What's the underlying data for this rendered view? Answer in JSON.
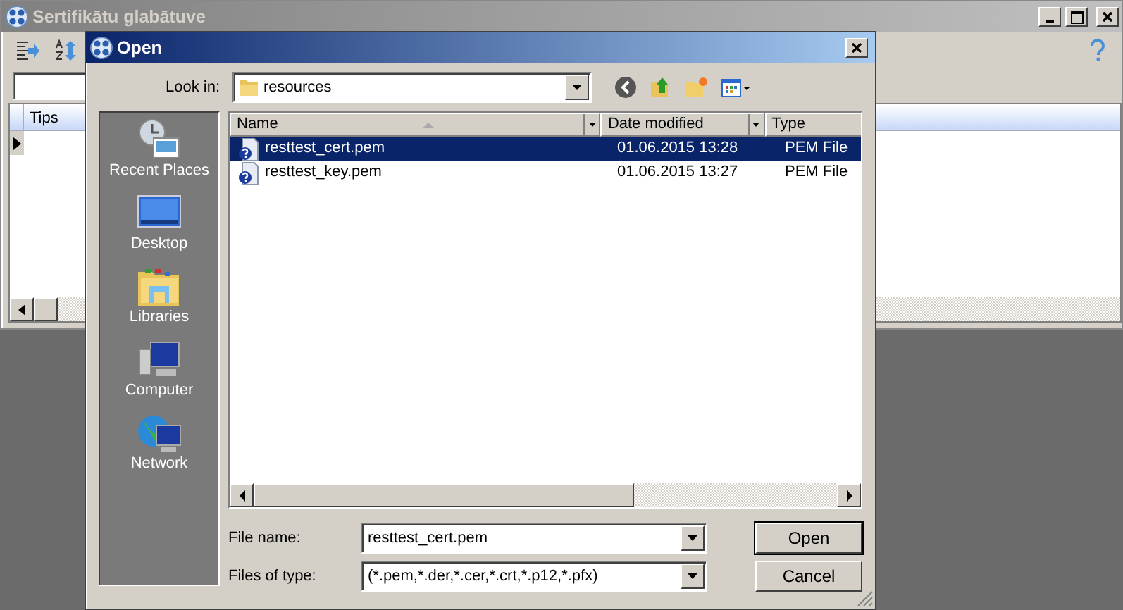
{
  "main_window": {
    "title": "Sertifikātu glabātuve",
    "table": {
      "columns": [
        "Tips"
      ]
    }
  },
  "dialog": {
    "title": "Open",
    "look_in": {
      "label": "Look in:",
      "value": "resources"
    },
    "places": [
      {
        "label": "Recent Places",
        "kind": "recent"
      },
      {
        "label": "Desktop",
        "kind": "desktop"
      },
      {
        "label": "Libraries",
        "kind": "libraries"
      },
      {
        "label": "Computer",
        "kind": "computer"
      },
      {
        "label": "Network",
        "kind": "network"
      }
    ],
    "file_list": {
      "columns": [
        {
          "label": "Name",
          "sorted": true
        },
        {
          "label": "Date modified",
          "sorted": false
        },
        {
          "label": "Type",
          "sorted": false
        }
      ],
      "rows": [
        {
          "name": "resttest_cert.pem",
          "date": "01.06.2015 13:28",
          "type": "PEM File",
          "selected": true
        },
        {
          "name": "resttest_key.pem",
          "date": "01.06.2015 13:27",
          "type": "PEM File",
          "selected": false
        }
      ]
    },
    "file_name": {
      "label": "File name:",
      "value": "resttest_cert.pem"
    },
    "file_type": {
      "label": "Files of type:",
      "value": "(*.pem,*.der,*.cer,*.crt,*.p12,*.pfx)"
    },
    "buttons": [
      {
        "label": "Open",
        "default": true
      },
      {
        "label": "Cancel",
        "default": false
      }
    ]
  }
}
